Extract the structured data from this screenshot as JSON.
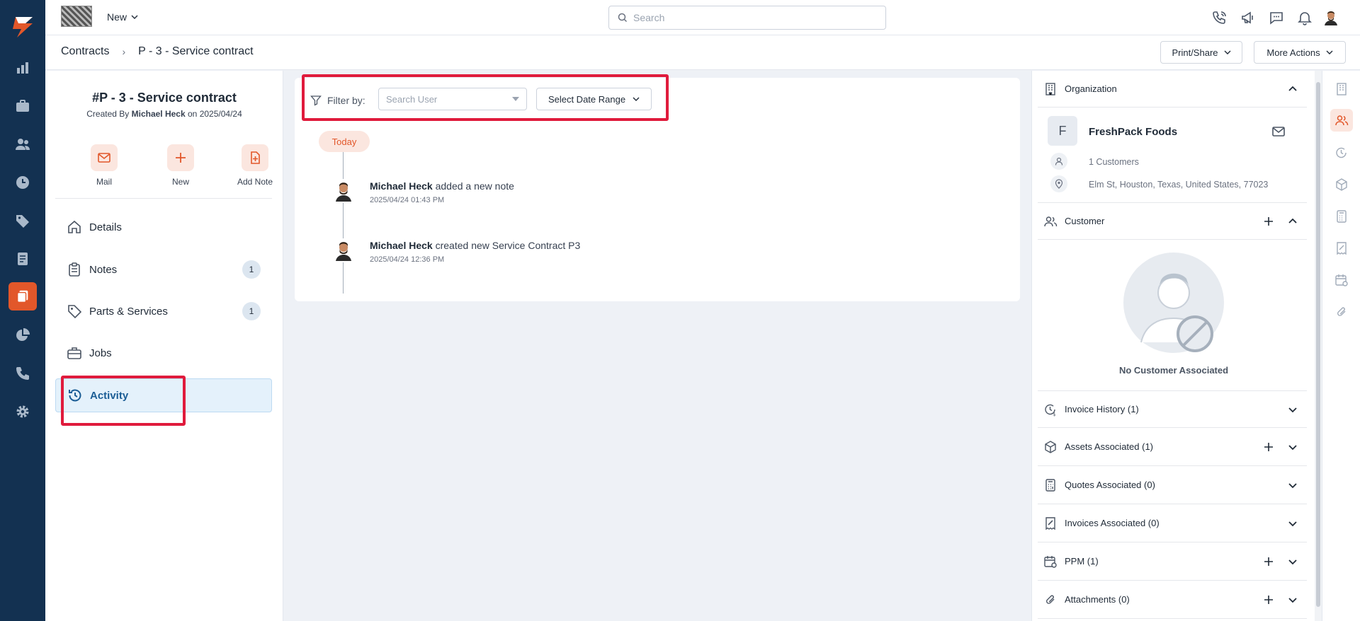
{
  "topbar": {
    "new_label": "New",
    "search_placeholder": "Search"
  },
  "breadcrumb": {
    "parent": "Contracts",
    "current": "P - 3 - Service contract"
  },
  "header_actions": {
    "print_share": "Print/Share",
    "more_actions": "More Actions"
  },
  "record": {
    "title": "#P - 3 - Service contract",
    "created_prefix": "Created By",
    "created_by": "Michael Heck",
    "created_on_word": "on",
    "created_date": "2025/04/24"
  },
  "quick_actions": [
    {
      "label": "Mail"
    },
    {
      "label": "New"
    },
    {
      "label": "Add Note"
    }
  ],
  "menu": [
    {
      "label": "Details",
      "count": ""
    },
    {
      "label": "Notes",
      "count": "1"
    },
    {
      "label": "Parts & Services",
      "count": "1"
    },
    {
      "label": "Jobs",
      "count": ""
    },
    {
      "label": "Activity",
      "count": ""
    }
  ],
  "activity": {
    "filter_label": "Filter by:",
    "search_user_placeholder": "Search User",
    "date_range_label": "Select Date Range",
    "today_label": "Today",
    "entries": [
      {
        "user": "Michael Heck",
        "action": "added a new note",
        "time": "2025/04/24 01:43 PM"
      },
      {
        "user": "Michael Heck",
        "action": "created new Service Contract P3",
        "time": "2025/04/24 12:36 PM"
      }
    ]
  },
  "right_panel": {
    "organization": {
      "header": "Organization",
      "initial": "F",
      "name": "FreshPack Foods",
      "customers": "1 Customers",
      "address": "Elm St, Houston, Texas, United States, 77023"
    },
    "customer": {
      "header": "Customer",
      "empty_text": "No Customer Associated"
    },
    "sections": [
      {
        "label": "Invoice History (1)"
      },
      {
        "label": "Assets Associated (1)"
      },
      {
        "label": "Quotes Associated (0)"
      },
      {
        "label": "Invoices Associated (0)"
      },
      {
        "label": "PPM (1)"
      },
      {
        "label": "Attachments (0)"
      }
    ]
  },
  "colors": {
    "brand_orange": "#e2572a",
    "nav_bg": "#133151",
    "highlight_red": "#e01b3c",
    "active_blue": "#1b5d95"
  }
}
